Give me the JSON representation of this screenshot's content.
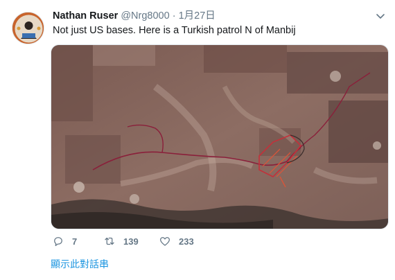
{
  "tweet": {
    "author_name": "Nathan Ruser",
    "handle": "@Nrg8000",
    "separator": "·",
    "date": "1月27日",
    "text": "Not just US bases. Here is a Turkish patrol N of Manbij",
    "show_thread": "顯示此對話串"
  },
  "actions": {
    "reply_count": "7",
    "retweet_count": "139",
    "like_count": "233"
  },
  "icons": {
    "avatar": "avatar",
    "caret": "chevron-down-icon",
    "reply": "reply-icon",
    "retweet": "retweet-icon",
    "like": "heart-icon"
  },
  "colors": {
    "text": "#14171a",
    "muted": "#657786",
    "link": "#1b95e0",
    "track": "#8a1f3a",
    "track_highlight": "#c4303a"
  }
}
